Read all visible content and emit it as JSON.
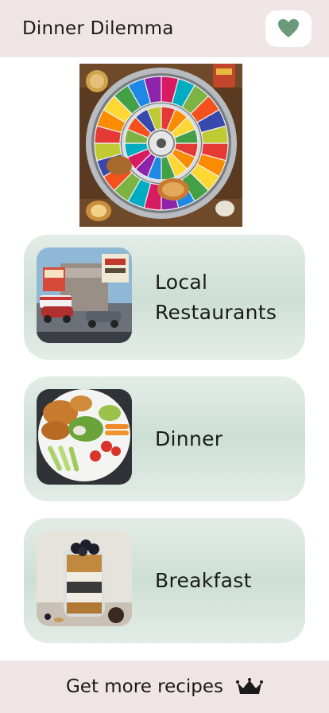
{
  "header": {
    "title": "Dinner Dilemma",
    "favorite_icon": "heart-icon"
  },
  "hero": {
    "image": "spinning wheel of food categories"
  },
  "cards": [
    {
      "label": "Local Restaurants",
      "thumb": "restaurant-photo"
    },
    {
      "label": "Dinner",
      "thumb": "dinner-plate-photo"
    },
    {
      "label": "Breakfast",
      "thumb": "breakfast-jar-photo"
    }
  ],
  "footer": {
    "label": "Get more recipes",
    "icon": "crown-icon"
  },
  "colors": {
    "header_bg": "#efe5e5",
    "card_bg": "#d6e4dc",
    "heart": "#6a9a7a"
  }
}
